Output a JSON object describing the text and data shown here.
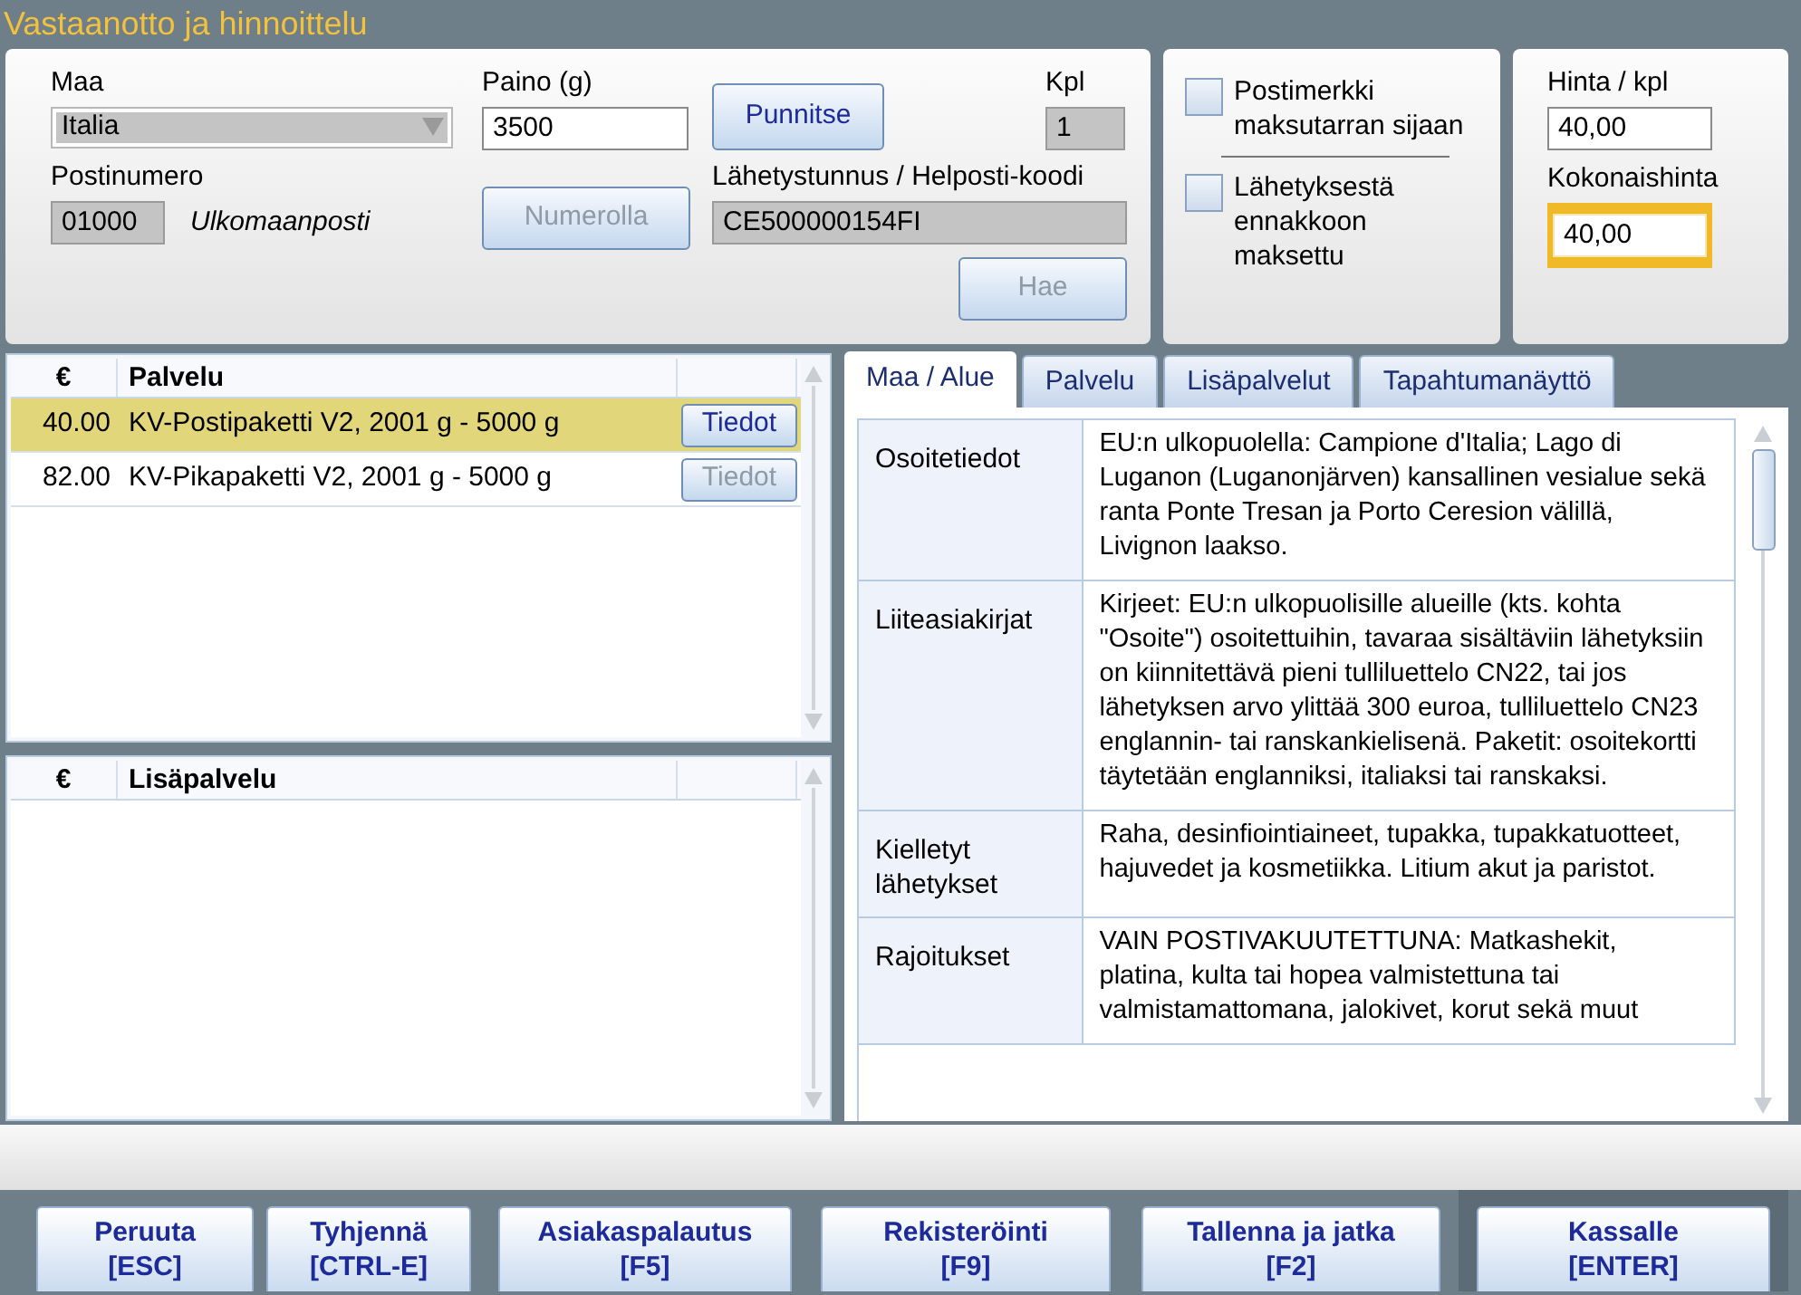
{
  "window": {
    "title": "Vastaanotto ja hinnoittelu"
  },
  "form": {
    "country": {
      "label": "Maa",
      "value": "Italia"
    },
    "weight": {
      "label": "Paino (g)",
      "value": "3500"
    },
    "weigh_button": {
      "label": "Punnitse",
      "disabled": false
    },
    "quantity": {
      "label": "Kpl",
      "value": "1"
    },
    "postal_code": {
      "label": "Postinumero",
      "value": "01000",
      "note": "Ulkomaanposti"
    },
    "number_button": {
      "label": "Numerolla",
      "disabled": true
    },
    "tracking": {
      "label": "Lähetystunnus / Helposti-koodi",
      "value": "CE500000154FI"
    },
    "search_button": {
      "label": "Hae",
      "disabled": true
    }
  },
  "options": [
    {
      "label": "Postimerkki maksutarran sijaan",
      "checked": false
    },
    {
      "label": "Lähetyksestä ennakkoon maksettu",
      "checked": false
    }
  ],
  "prices": {
    "unit": {
      "label": "Hinta / kpl",
      "value": "40,00",
      "focused": false
    },
    "total": {
      "label": "Kokonaishinta",
      "value": "40,00",
      "focused": true
    }
  },
  "services": {
    "columns": [
      "€",
      "Palvelu"
    ],
    "rows": [
      {
        "price": "40.00",
        "name": "KV-Postipaketti V2, 2001 g - 5000 g",
        "button": "Tiedot",
        "button_disabled": false,
        "selected": true
      },
      {
        "price": "82.00",
        "name": "KV-Pikapaketti V2, 2001 g - 5000 g",
        "button": "Tiedot",
        "button_disabled": true,
        "selected": false
      }
    ]
  },
  "extra_services": {
    "columns": [
      "€",
      "Lisäpalvelu"
    ]
  },
  "tabs": [
    {
      "label": "Maa / Alue",
      "selected": true
    },
    {
      "label": "Palvelu",
      "selected": false
    },
    {
      "label": "Lisäpalvelut",
      "selected": false
    },
    {
      "label": "Tapahtumanäyttö",
      "selected": false
    }
  ],
  "info_rows": [
    {
      "label": "Osoitetiedot",
      "text": "EU:n ulkopuolella: Campione d'Italia; Lago di Luganon (Luganonjärven) kansallinen vesialue sekä ranta Ponte Tresan ja Porto Ceresion välillä, Livignon laakso."
    },
    {
      "label": "Liiteasiakirjat",
      "text": "Kirjeet: EU:n ulkopuolisille alueille (kts. kohta \"Osoite\") osoitettuihin, tavaraa sisältäviin lähetyksiin on kiinnitettävä pieni tulliluettelo CN22, tai jos lähetyksen arvo ylittää 300 euroa, tulliluettelo CN23 englannin- tai ranskankielisenä. Paketit: osoitekortti täytetään englanniksi, italiaksi tai ranskaksi."
    },
    {
      "label": "Kielletyt lähetykset",
      "text": "Raha, desinfiointiaineet, tupakka, tupakkatuotteet, hajuvedet ja kosmetiikka. Litium akut ja paristot."
    },
    {
      "label": "Rajoitukset",
      "text": "VAIN POSTIVAKUUTETTUNA: Matkashekit, platina, kulta tai hopea valmistettuna tai valmistamattomana, jalokivet, korut sekä muut"
    }
  ],
  "buttons": [
    {
      "label": "Peruuta",
      "key": "[ESC]"
    },
    {
      "label": "Tyhjennä",
      "key": "[CTRL-E]"
    },
    {
      "label": "Asiakaspalautus",
      "key": "[F5]"
    },
    {
      "label": "Rekisteröinti",
      "key": "[F9]"
    },
    {
      "label": "Tallenna ja jatka",
      "key": "[F2]"
    },
    {
      "label": "Kassalle",
      "key": "[ENTER]"
    }
  ]
}
